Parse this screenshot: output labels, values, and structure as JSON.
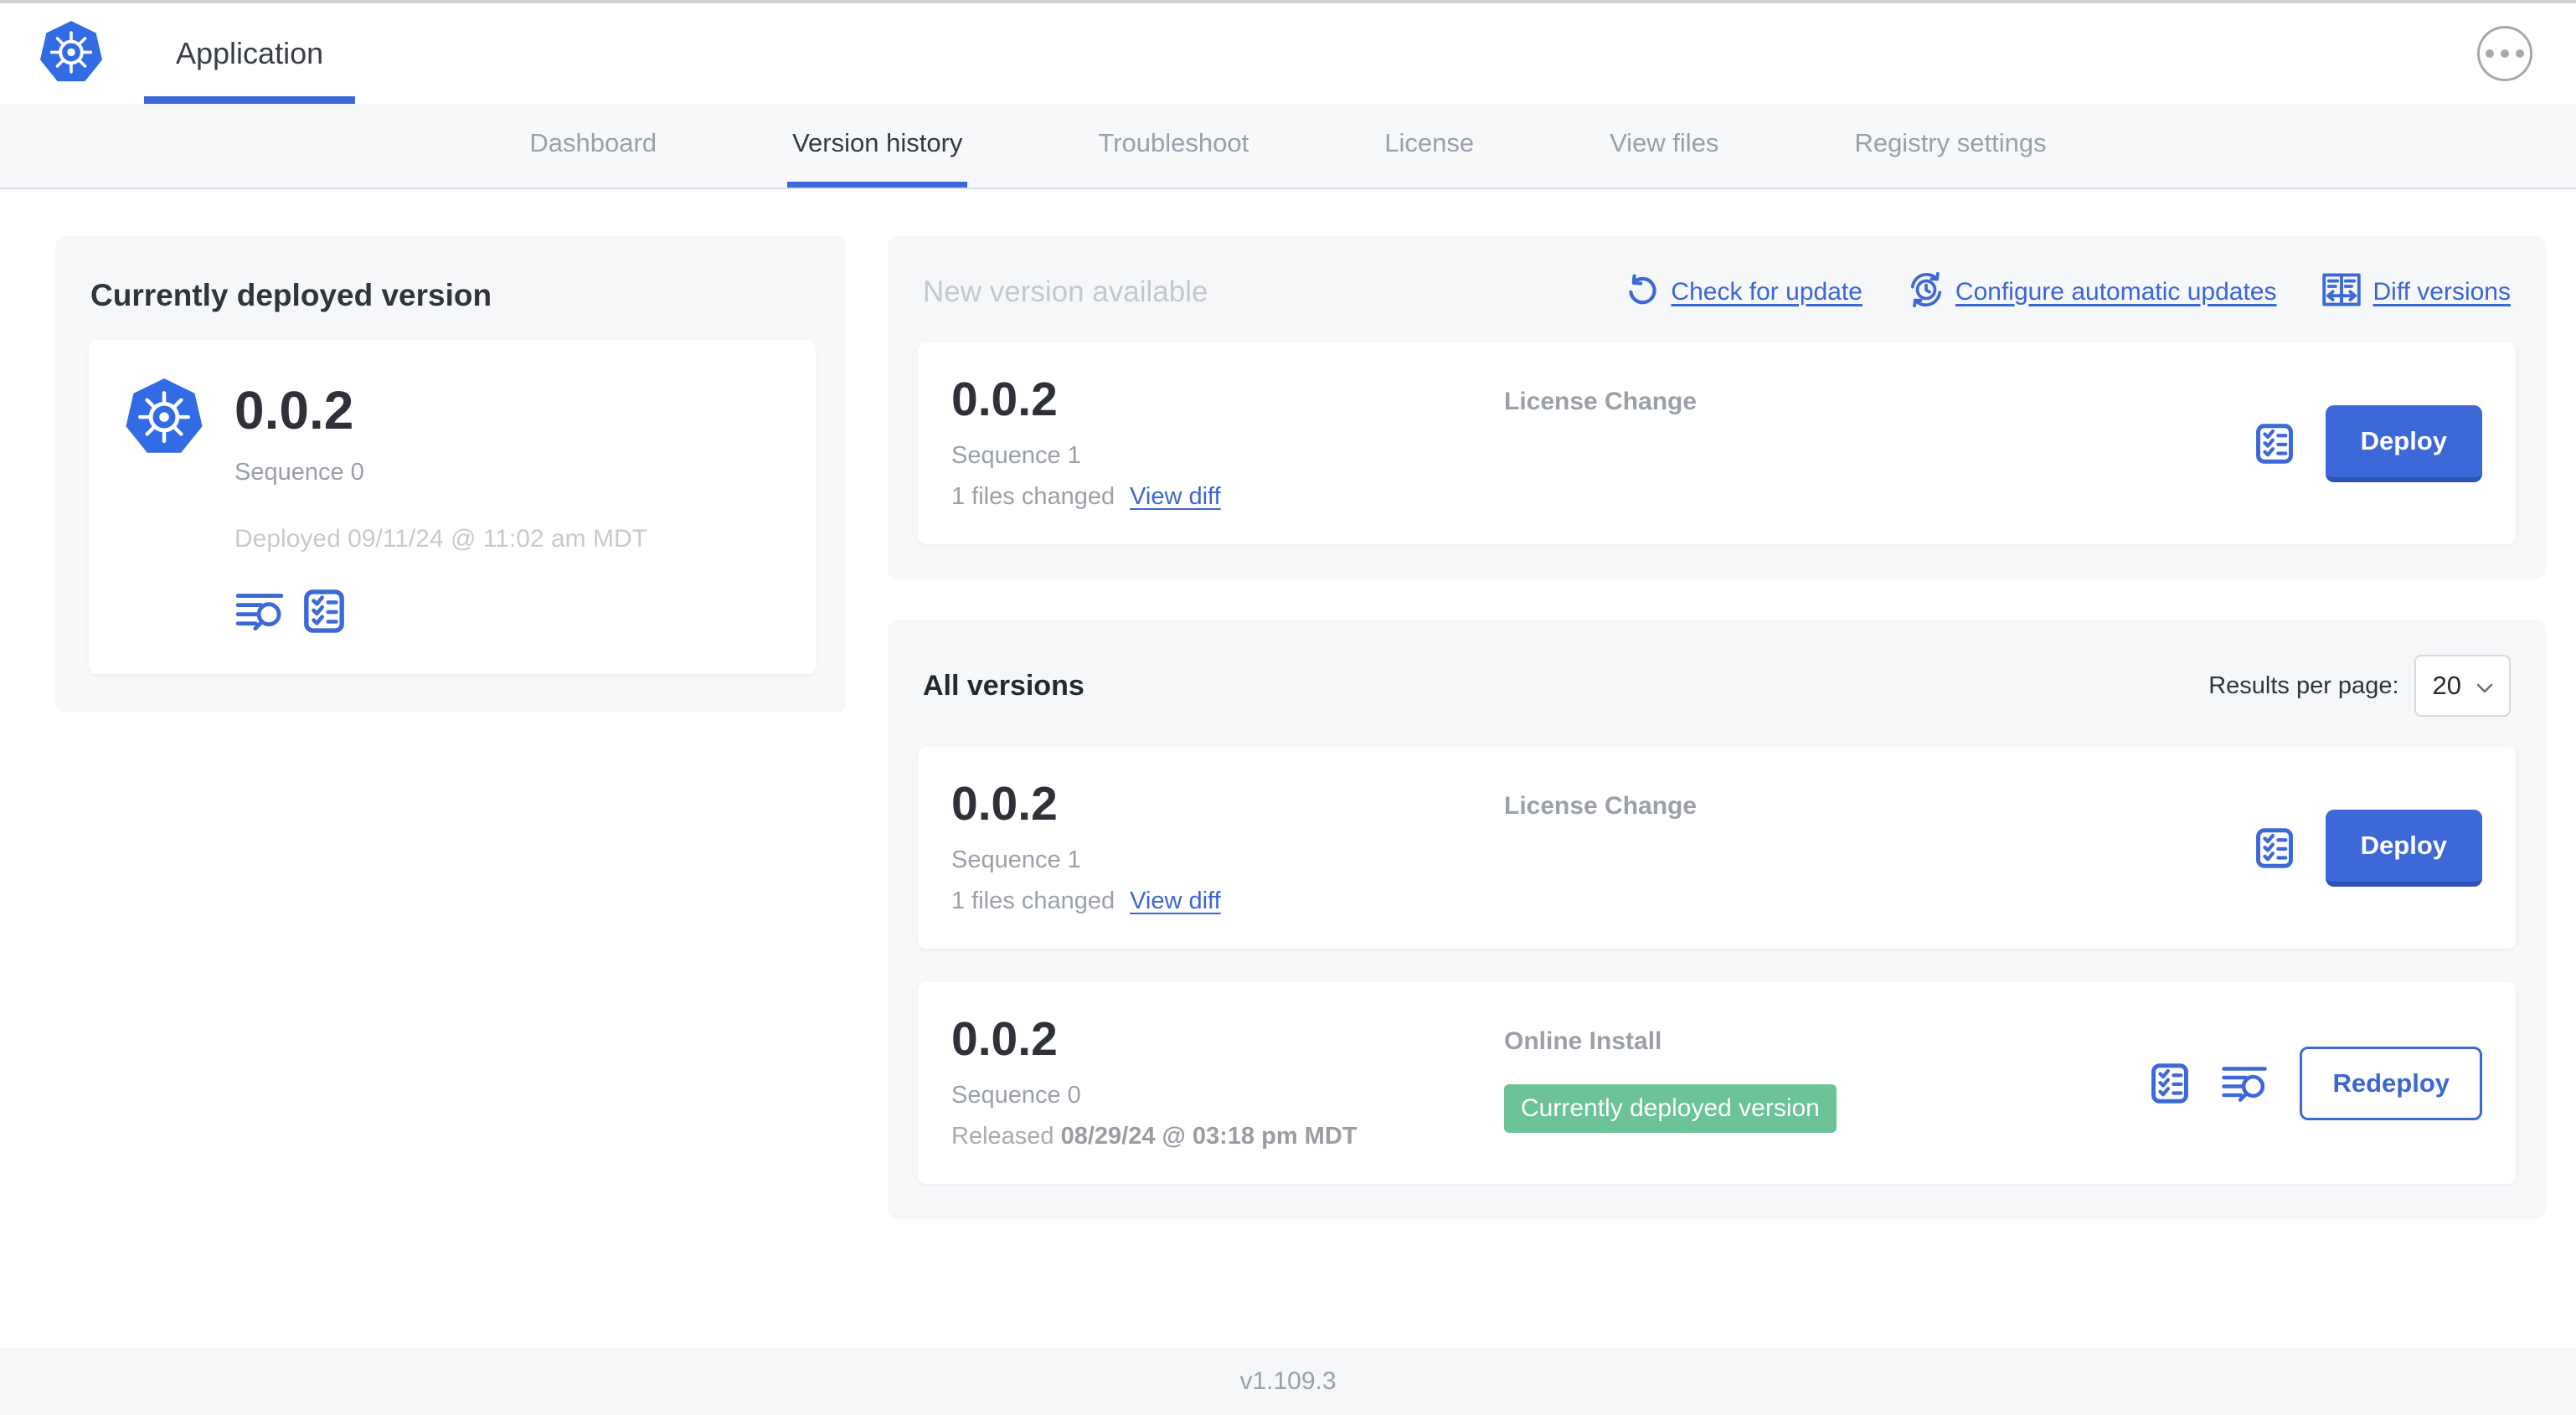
{
  "header": {
    "product_tab": "Application"
  },
  "nav": {
    "tabs": [
      "Dashboard",
      "Version history",
      "Troubleshoot",
      "License",
      "View files",
      "Registry settings"
    ],
    "active_tab": "Version history"
  },
  "current": {
    "title": "Currently deployed version",
    "version": "0.0.2",
    "sequence": "Sequence 0",
    "deployed": "Deployed 09/11/24 @ 11:02 am MDT"
  },
  "new_version": {
    "title": "New version available",
    "links": [
      {
        "icon": "check-for-update-icon",
        "label": "Check for update"
      },
      {
        "icon": "configure-updates-icon",
        "label": "Configure automatic updates"
      },
      {
        "icon": "diff-versions-icon",
        "label": "Diff versions"
      }
    ],
    "row": {
      "version": "0.0.2",
      "sequence": "Sequence 1",
      "files_changed": "1 files changed",
      "view_diff": "View diff",
      "source": "License Change",
      "action": "Deploy"
    }
  },
  "all_versions": {
    "title": "All versions",
    "results_per_page_label": "Results per page:",
    "results_per_page_value": "20",
    "rows": [
      {
        "version": "0.0.2",
        "sequence": "Sequence 1",
        "files_changed": "1 files changed",
        "view_diff": "View diff",
        "source": "License Change",
        "action": "Deploy"
      },
      {
        "version": "0.0.2",
        "sequence": "Sequence 0",
        "released_prefix": "Released ",
        "released_date": "08/29/24 @ 03:18 pm MDT",
        "source": "Online Install",
        "badge": "Currently deployed version",
        "action": "Redeploy"
      }
    ]
  },
  "footer": {
    "version": "v1.109.3"
  },
  "icons": [
    "kubernetes-logo",
    "ellipsis-menu-icon",
    "deploy-logs-icon",
    "preflight-checks-icon",
    "check-for-update-icon",
    "configure-updates-icon",
    "diff-versions-icon",
    "chevron-down-icon"
  ],
  "colors": {
    "primary_blue": "#3d68d8",
    "link_blue": "#3b66d4",
    "k8s_blue": "#326ce5",
    "badge_green": "#6cc398",
    "panel_bg": "#f5f7f9"
  }
}
